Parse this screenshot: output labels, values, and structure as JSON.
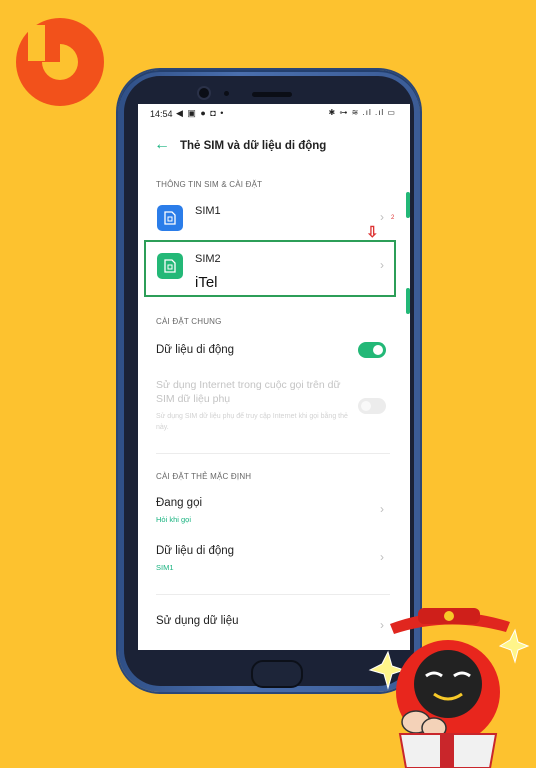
{
  "colors": {
    "background": "#FDC22F",
    "accent": "#23B877",
    "sim1": "#2B7DE9",
    "highlight_border": "#2C9E58",
    "annotation": "#DD3333"
  },
  "status_bar": {
    "time": "14:54",
    "left_icons": "◀ ▣ ● ◘ •",
    "right_icons": "✱ ⊶ ≋ .ıl .ıl ▭"
  },
  "header": {
    "back_icon": "arrow-left-icon",
    "title": "Thẻ SIM và dữ liệu di động"
  },
  "sim_section": {
    "header": "THÔNG TIN SIM & CÀI ĐẶT",
    "sims": [
      {
        "label": "SIM1",
        "icon": "sim-card-icon"
      },
      {
        "label": "SIM2",
        "icon": "sim-card-icon",
        "carrier_note": "iTel"
      }
    ],
    "annotation_arrow": "⇩",
    "badge": "2"
  },
  "general_section": {
    "header": "CÀI ĐẶT CHUNG",
    "mobile_data_label": "Dữ liệu di động",
    "mobile_data_on": true,
    "secondary_internet_title": "Sử dụng Internet trong cuộc gọi trên dữ SIM dữ liệu phụ",
    "secondary_internet_desc": "Sử dụng SIM dữ liệu phụ để truy cập Internet khi gọi bằng thẻ này.",
    "secondary_internet_on": false
  },
  "default_section": {
    "header": "CÀI ĐẶT THẺ MẶC ĐỊNH",
    "calls_label": "Đang gọi",
    "calls_value": "Hỏi khi gọi",
    "data_label": "Dữ liệu di động",
    "data_value": "SIM1",
    "usage_label": "Sử dụng dữ liệu"
  }
}
